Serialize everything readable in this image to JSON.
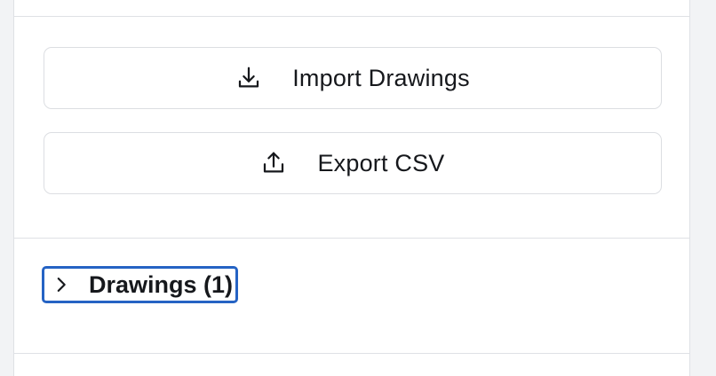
{
  "actions": {
    "import": {
      "label": "Import Drawings",
      "icon": "download-icon"
    },
    "export": {
      "label": "Export CSV",
      "icon": "upload-icon"
    }
  },
  "drawings_section": {
    "label": "Drawings (1)",
    "icon": "chevron-right-icon",
    "expanded": false
  },
  "colors": {
    "focus_ring": "#2563c4",
    "border": "#dcdee2",
    "text": "#16181c",
    "background": "#f2f3f5"
  }
}
